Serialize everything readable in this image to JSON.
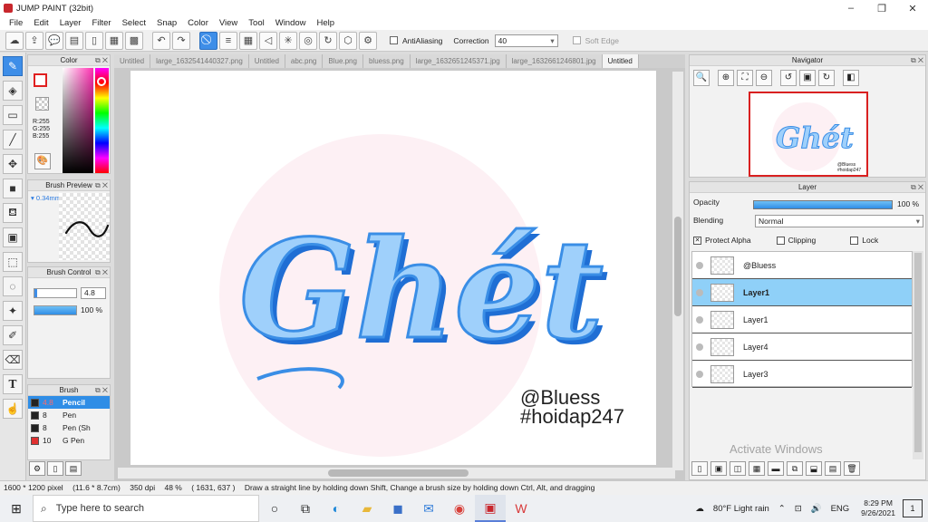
{
  "window": {
    "title": "JUMP PAINT (32bit)",
    "controls": [
      "–",
      "❐",
      "✕"
    ]
  },
  "menu": [
    "File",
    "Edit",
    "Layer",
    "Filter",
    "Select",
    "Snap",
    "Color",
    "View",
    "Tool",
    "Window",
    "Help"
  ],
  "toolbar": {
    "antialiasing_label": "AntiAliasing",
    "correction_label": "Correction",
    "correction_value": "40",
    "softedge_label": "Soft Edge"
  },
  "color_panel": {
    "title": "Color",
    "rgb": [
      "R:255",
      "G:255",
      "B:255"
    ],
    "accent": "#ff2fb2"
  },
  "brush_preview": {
    "title": "Brush Preview",
    "size": "0.34mm"
  },
  "brush_control": {
    "title": "Brush Control",
    "size_value": "4.8",
    "opacity_value": "100 %"
  },
  "brush_list": {
    "title": "Brush",
    "items": [
      {
        "size": "4.8",
        "name": "Pencil",
        "color": "#222222",
        "active": true
      },
      {
        "size": "8",
        "name": "Pen",
        "color": "#222222",
        "active": false
      },
      {
        "size": "8",
        "name": "Pen (Sh",
        "color": "#222222",
        "active": false
      },
      {
        "size": "10",
        "name": "G Pen",
        "color": "#e03030",
        "active": false
      }
    ]
  },
  "tabs": [
    {
      "label": "Untitled",
      "active": false
    },
    {
      "label": "large_1632541440327.png",
      "active": false
    },
    {
      "label": "Untitled",
      "active": false
    },
    {
      "label": "abc.png",
      "active": false
    },
    {
      "label": "Blue.png",
      "active": false
    },
    {
      "label": "bluess.png",
      "active": false
    },
    {
      "label": "large_1632651245371.jpg",
      "active": false
    },
    {
      "label": "large_1632661246801.jpg",
      "active": false
    },
    {
      "label": "Untitled",
      "active": true
    }
  ],
  "canvas": {
    "artwork_text": "Ghét",
    "watermark_lines": [
      "@Bluess",
      "#hoidap247"
    ],
    "ink_color": "#3a8ee6"
  },
  "navigator": {
    "title": "Navigator"
  },
  "layer_panel": {
    "title": "Layer",
    "opacity_label": "Opacity",
    "opacity_value": "100 %",
    "opacity_level": 1.0,
    "blending_label": "Blending",
    "blending_value": "Normal",
    "protect_alpha_label": "Protect Alpha",
    "clipping_label": "Clipping",
    "lock_label": "Lock",
    "layers": [
      {
        "name": "@Bluess",
        "selected": false
      },
      {
        "name": "Layer1",
        "selected": true
      },
      {
        "name": "Layer1",
        "selected": false
      },
      {
        "name": "Layer4",
        "selected": false
      },
      {
        "name": "Layer3",
        "selected": false
      }
    ],
    "activate_windows": "Activate Windows"
  },
  "statusbar": {
    "size": "1600 * 1200 pixel",
    "cm": "(11.6 * 8.7cm)",
    "dpi": "350 dpi",
    "zoom": "48 %",
    "cursor": "( 1631, 637 )",
    "hint": "Draw a straight line by holding down Shift, Change a brush size by holding down Ctrl, Alt, and dragging"
  },
  "taskbar": {
    "search_placeholder": "Type here to search",
    "weather": "80°F  Light rain",
    "lang": "ENG",
    "time": "8:29 PM",
    "date": "9/26/2021",
    "notifications": "1"
  }
}
